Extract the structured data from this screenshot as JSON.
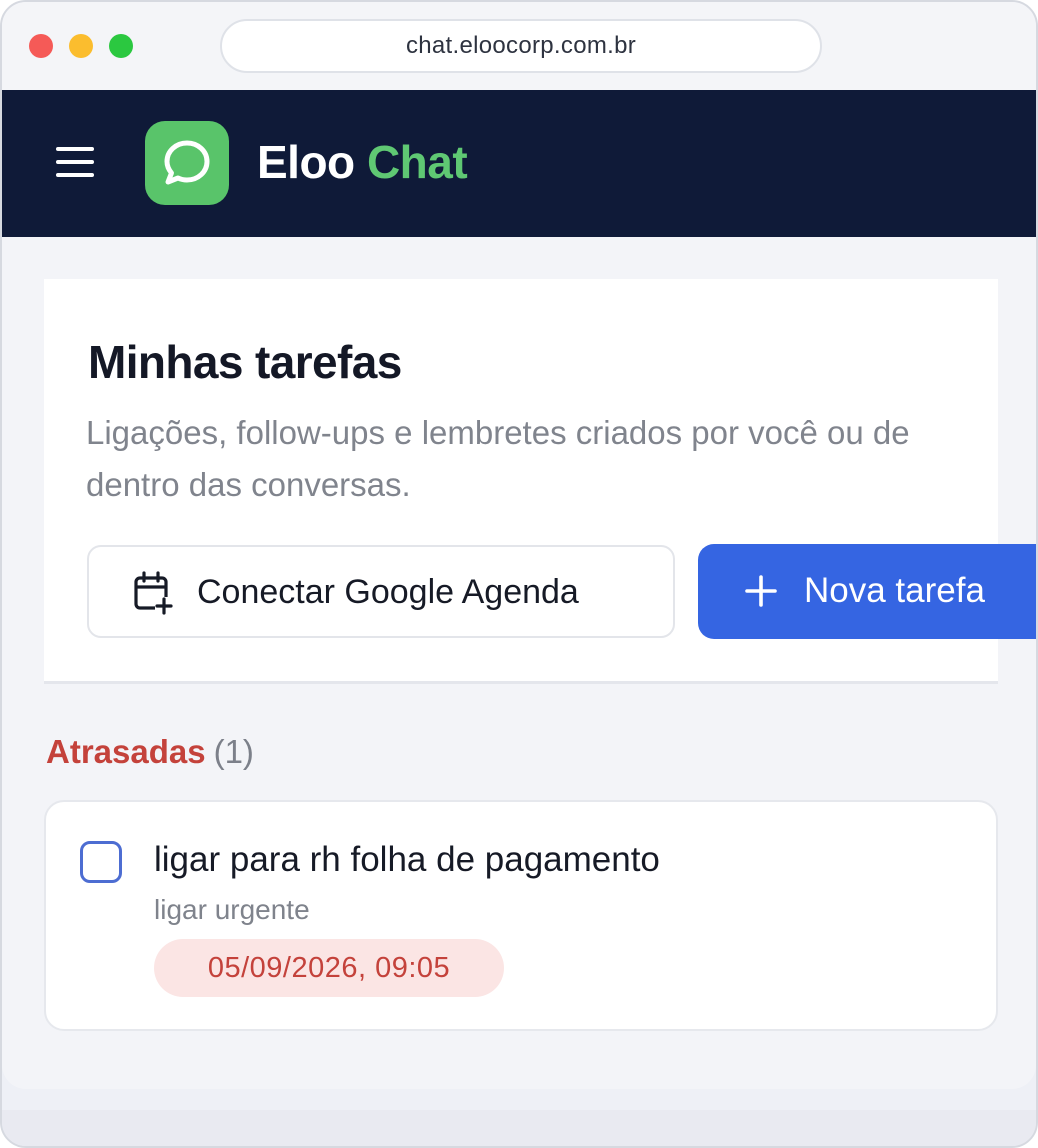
{
  "browser": {
    "url": "chat.eloocorp.com.br"
  },
  "header": {
    "brand_part1": "Eloo",
    "brand_part2": "Chat",
    "logo_icon": "chat-bubble-icon",
    "menu_icon": "hamburger-menu-icon",
    "colors": {
      "navbar": "#0f1a38",
      "brand_green": "#5fc873"
    }
  },
  "page": {
    "title": "Minhas tarefas",
    "subtitle": "Ligações, follow-ups e lembretes criados por você ou de dentro das conversas.",
    "connect_button_label": "Conectar Google Agenda",
    "connect_button_icon": "calendar-plus-icon",
    "new_task_button_label": "Nova tarefa",
    "new_task_button_icon": "plus-icon",
    "colors": {
      "primary": "#3565e2",
      "overdue": "#c4423b"
    }
  },
  "sections": [
    {
      "name": "Atrasadas",
      "count": "(1)",
      "tasks": [
        {
          "title": "ligar para rh folha de pagamento",
          "note": "ligar urgente",
          "due": "05/09/2026, 09:05",
          "done": false
        }
      ]
    }
  ]
}
